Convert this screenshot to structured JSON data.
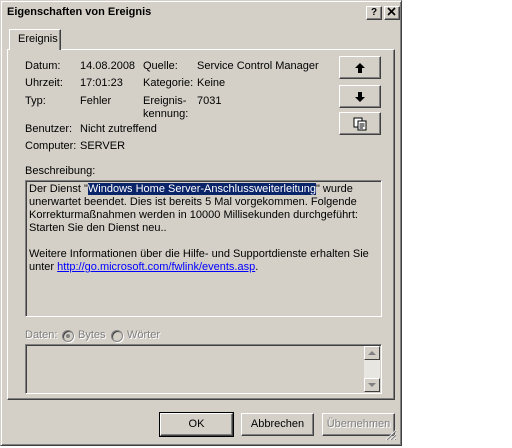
{
  "window": {
    "title": "Eigenschaften von Ereignis",
    "help_button": "?",
    "close_button": "✕"
  },
  "tabs": [
    {
      "label": "Ereignis",
      "active": true
    }
  ],
  "fields": {
    "datum_label": "Datum:",
    "datum_value": "14.08.2008",
    "uhrzeit_label": "Uhrzeit:",
    "uhrzeit_value": "17:01:23",
    "typ_label": "Typ:",
    "typ_value": "Fehler",
    "benutzer_label": "Benutzer:",
    "benutzer_value": "Nicht zutreffend",
    "computer_label": "Computer:",
    "computer_value": "SERVER",
    "quelle_label": "Quelle:",
    "quelle_value": "Service Control Manager",
    "kategorie_label": "Kategorie:",
    "kategorie_value": "Keine",
    "ereignis_label_1": "Ereignis-",
    "ereignis_label_2": "kennung:",
    "ereignis_value": "7031"
  },
  "nav_buttons": [
    {
      "icon": "arrow-up-icon"
    },
    {
      "icon": "arrow-down-icon"
    },
    {
      "icon": "copy-icon"
    }
  ],
  "description": {
    "label": "Beschreibung:",
    "line1_pre": "Der Dienst \"",
    "line1_selected": "Windows Home Server-Anschlussweiterleitung",
    "line1_post": "\" wurde",
    "line2": "unerwartet beendet. Dies ist bereits 5 Mal vorgekommen. Folgende",
    "line3": "Korrekturmaßnahmen werden in 10000 Millisekunden durchgeführt:",
    "line4": "Starten Sie den Dienst neu..",
    "line5": "Weitere Informationen über die Hilfe- und Supportdienste erhalten Sie",
    "line6_pre": "unter ",
    "line6_link": "http://go.microsoft.com/fwlink/events.asp",
    "line6_post": "."
  },
  "data_section": {
    "label": "Daten:",
    "option_bytes": "Bytes",
    "option_words": "Wörter",
    "selected": "Bytes"
  },
  "buttons": {
    "ok": "OK",
    "cancel": "Abbrechen",
    "apply": "Übernehmen"
  },
  "colors": {
    "face": "#d4d0c8",
    "selection": "#0a246a",
    "link": "#0000ff"
  }
}
